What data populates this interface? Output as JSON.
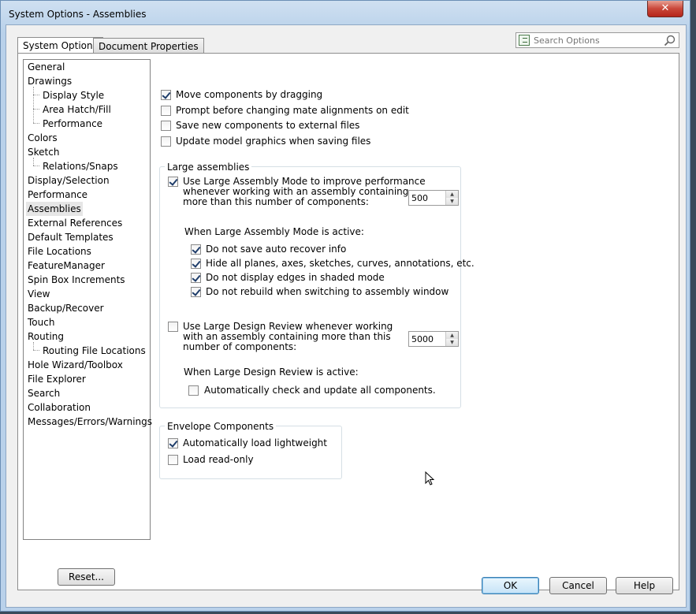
{
  "window": {
    "title": "System Options - Assemblies",
    "close_glyph": "✕"
  },
  "tabs": [
    {
      "label": "System Options",
      "active": true
    },
    {
      "label": "Document Properties",
      "active": false
    }
  ],
  "search": {
    "placeholder": "Search Options",
    "icon": "magnifier-icon"
  },
  "tree": {
    "items": [
      {
        "label": "General"
      },
      {
        "label": "Drawings"
      },
      {
        "label": "Display Style",
        "child": true
      },
      {
        "label": "Area Hatch/Fill",
        "child": true
      },
      {
        "label": "Performance",
        "child": true
      },
      {
        "label": "Colors"
      },
      {
        "label": "Sketch"
      },
      {
        "label": "Relations/Snaps",
        "child": true
      },
      {
        "label": "Display/Selection"
      },
      {
        "label": "Performance"
      },
      {
        "label": "Assemblies",
        "selected": true
      },
      {
        "label": "External References"
      },
      {
        "label": "Default Templates"
      },
      {
        "label": "File Locations"
      },
      {
        "label": "FeatureManager"
      },
      {
        "label": "Spin Box Increments"
      },
      {
        "label": "View"
      },
      {
        "label": "Backup/Recover"
      },
      {
        "label": "Touch"
      },
      {
        "label": "Routing"
      },
      {
        "label": "Routing File Locations",
        "child": true
      },
      {
        "label": "Hole Wizard/Toolbox"
      },
      {
        "label": "File Explorer"
      },
      {
        "label": "Search"
      },
      {
        "label": "Collaboration"
      },
      {
        "label": "Messages/Errors/Warnings"
      }
    ]
  },
  "reset_label": "Reset...",
  "options": {
    "move_by_dragging": {
      "label": "Move components by dragging",
      "checked": true
    },
    "prompt_mate": {
      "label": "Prompt before changing mate alignments on edit",
      "checked": false
    },
    "save_external": {
      "label": "Save new components to external files",
      "checked": false
    },
    "update_graphics": {
      "label": "Update model graphics when saving files",
      "checked": false
    }
  },
  "large_assemblies": {
    "title": "Large assemblies",
    "use_mode": {
      "line1": "Use Large Assembly Mode to improve performance",
      "line2": "whenever working with an assembly containing",
      "line3": "more than this number of components:",
      "checked": true
    },
    "threshold": "500",
    "active_heading": "When Large Assembly Mode is active:",
    "sub": [
      {
        "label": "Do not save auto recover info",
        "checked": true
      },
      {
        "label": "Hide all planes, axes, sketches, curves, annotations, etc.",
        "checked": true
      },
      {
        "label": "Do not display edges in shaded mode",
        "checked": true
      },
      {
        "label": "Do not rebuild when switching to assembly window",
        "checked": true
      }
    ],
    "design_review": {
      "line1": "Use Large Design Review whenever working",
      "line2": "with an assembly containing more than this",
      "line3": "number of components:",
      "checked": false
    },
    "review_threshold": "5000",
    "review_heading": "When Large Design Review is active:",
    "auto_check": {
      "label": "Automatically check and update all components.",
      "checked": false
    }
  },
  "envelope": {
    "title": "Envelope Components",
    "load_lightweight": {
      "label": "Automatically load lightweight",
      "checked": true
    },
    "load_readonly": {
      "label": "Load read-only",
      "checked": false
    }
  },
  "footer": {
    "ok": "OK",
    "cancel": "Cancel",
    "help": "Help"
  }
}
